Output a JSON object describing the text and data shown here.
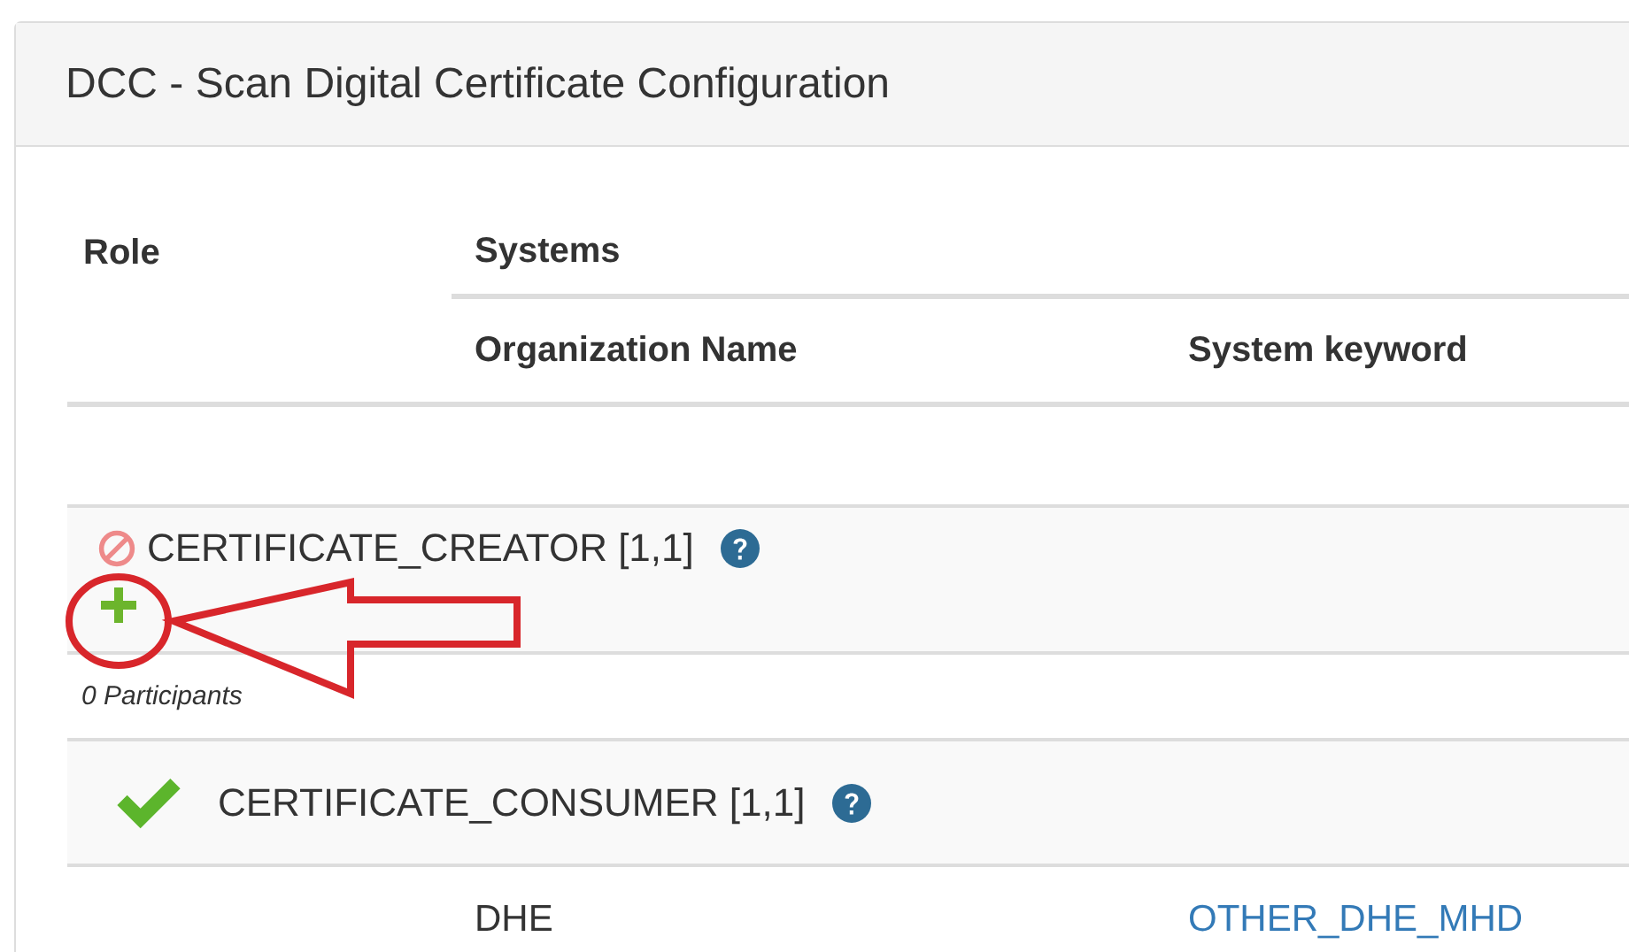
{
  "panel": {
    "title": "DCC - Scan Digital Certificate Configuration"
  },
  "table": {
    "columns": {
      "role": "Role",
      "systems": "Systems",
      "organization": "Organization Name",
      "keyword": "System keyword"
    },
    "roles": [
      {
        "name": "CERTIFICATE_CREATOR [1,1]",
        "fulfilled": false,
        "highlighted": true,
        "participants": "0 Participants"
      },
      {
        "name": "CERTIFICATE_CONSUMER [1,1]",
        "fulfilled": true,
        "highlighted": false,
        "systems": [
          {
            "organization": "DHE",
            "keyword": "OTHER_DHE_MHD"
          }
        ]
      }
    ]
  }
}
